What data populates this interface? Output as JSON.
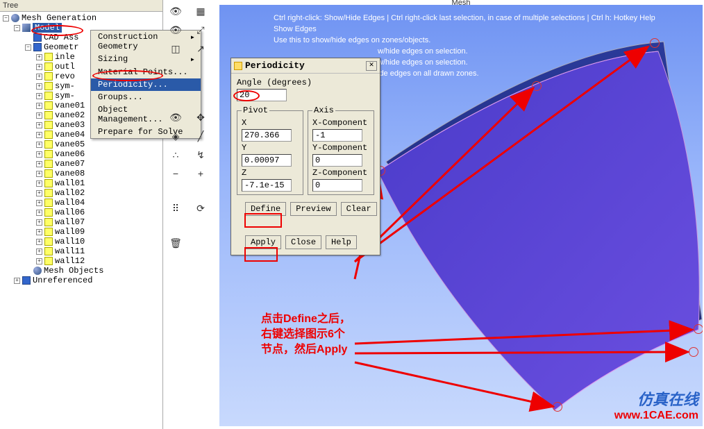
{
  "tree": {
    "header": "Tree",
    "root": "Mesh Generation",
    "model": "Model",
    "cad_ass": "CAD Ass",
    "geometry": "Geometr",
    "items": [
      "inle",
      "outl",
      "revo",
      "sym-",
      "sym-",
      "vane01",
      "vane02",
      "vane03",
      "vane04",
      "vane05",
      "vane06",
      "vane07",
      "vane08",
      "wall01",
      "wall02",
      "wall04",
      "wall06",
      "wall07",
      "wall09",
      "wall10",
      "wall11",
      "wall12"
    ],
    "mesh_objects": "Mesh Objects",
    "unreferenced": "Unreferenced"
  },
  "context_menu": {
    "items": [
      "Construction Geometry",
      "Sizing",
      "Material Points...",
      "Periodicity...",
      "Groups...",
      "Object Management...",
      "Prepare for Solve"
    ],
    "submenu_arrows": [
      true,
      true,
      false,
      false,
      false,
      false,
      false
    ],
    "selected_index": 3
  },
  "viewport": {
    "title": "Mesh",
    "help": [
      "Ctrl right-click: Show/Hide Edges | Ctrl right-click last selection, in case of multiple selections | Ctrl h: Hotkey Help",
      "Show Edges",
      "    Use this to show/hide edges on zones/objects.",
      "",
      "",
      ""
    ],
    "help_rhs": [
      "w/hide edges on selection.",
      "w/hide edges on selection.",
      "ide edges on all drawn zones."
    ]
  },
  "dialog": {
    "title": "Periodicity",
    "angle_label": "Angle (degrees)",
    "angle": "20",
    "pivot_label": "Pivot",
    "axis_label": "Axis",
    "x_label": "X",
    "x": "270.366",
    "y_label": "Y",
    "y": "0.00097",
    "z_label": "Z",
    "z": "-7.1e-15",
    "xc_label": "X-Component",
    "xc": "-1",
    "yc_label": "Y-Component",
    "yc": "0",
    "zc_label": "Z-Component",
    "zc": "0",
    "define": "Define",
    "preview": "Preview",
    "clear": "Clear",
    "apply": "Apply",
    "close": "Close",
    "help": "Help"
  },
  "annotation": {
    "line1": "点击Define之后，",
    "line2": "右键选择图示6个",
    "line3": "节点，然后Apply"
  },
  "watermark": {
    "cn": "仿真在线",
    "url": "www.1CAE.com"
  }
}
